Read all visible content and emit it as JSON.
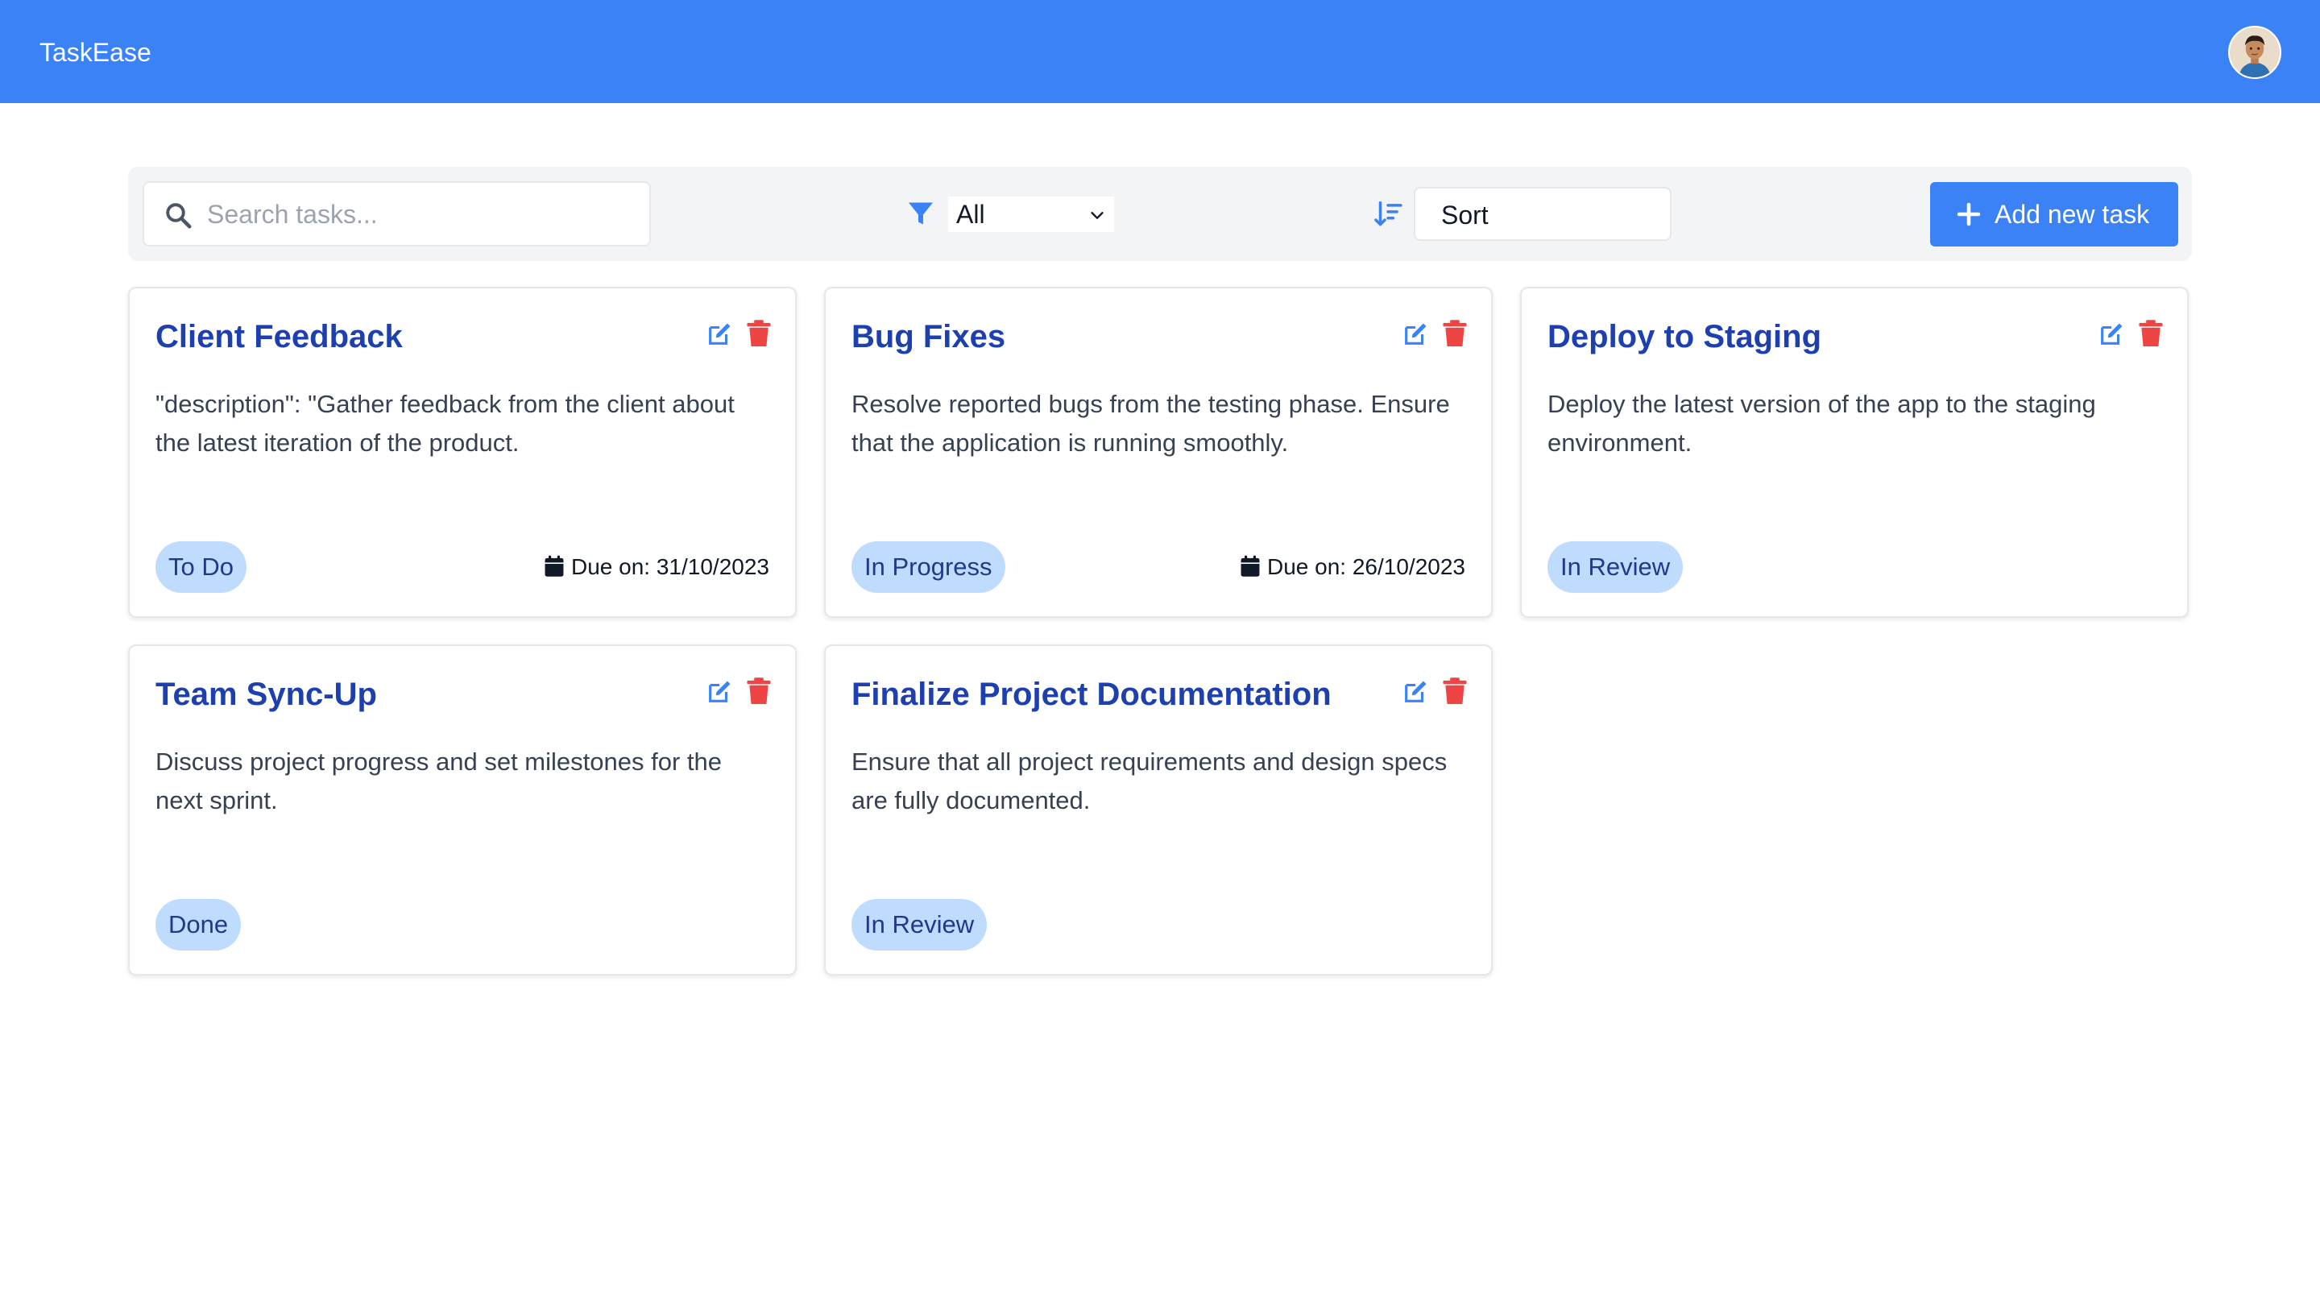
{
  "app": {
    "brand": "TaskEase",
    "colors": {
      "primary": "#3b82f6",
      "danger": "#ef4444",
      "title": "#1e40af",
      "badge_bg": "#bfdbfe",
      "badge_text": "#1e3a8a"
    }
  },
  "header": {
    "avatar_icon": "user-avatar"
  },
  "toolbar": {
    "search": {
      "placeholder": "Search tasks...",
      "value": "",
      "icon": "search-icon"
    },
    "filter": {
      "icon": "filter-icon",
      "selected": "All"
    },
    "sort": {
      "icon": "sort-descending-icon",
      "label": "Sort"
    },
    "add_button": {
      "icon": "plus-icon",
      "label": "Add new task"
    }
  },
  "tasks": [
    {
      "title": "Client Feedback",
      "description": "\"description\": \"Gather feedback from the client about the latest iteration of the product.",
      "status": "To Do",
      "due": "Due on: 31/10/2023"
    },
    {
      "title": "Bug Fixes",
      "description": "Resolve reported bugs from the testing phase. Ensure that the application is running smoothly.",
      "status": "In Progress",
      "due": "Due on: 26/10/2023"
    },
    {
      "title": "Deploy to Staging",
      "description": "Deploy the latest version of the app to the staging environment.",
      "status": "In Review",
      "due": ""
    },
    {
      "title": "Team Sync-Up",
      "description": "Discuss project progress and set milestones for the next sprint.",
      "status": "Done",
      "due": ""
    },
    {
      "title": "Finalize Project Documentation",
      "description": "Ensure that all project requirements and design specs are fully documented.",
      "status": "In Review",
      "due": ""
    }
  ]
}
